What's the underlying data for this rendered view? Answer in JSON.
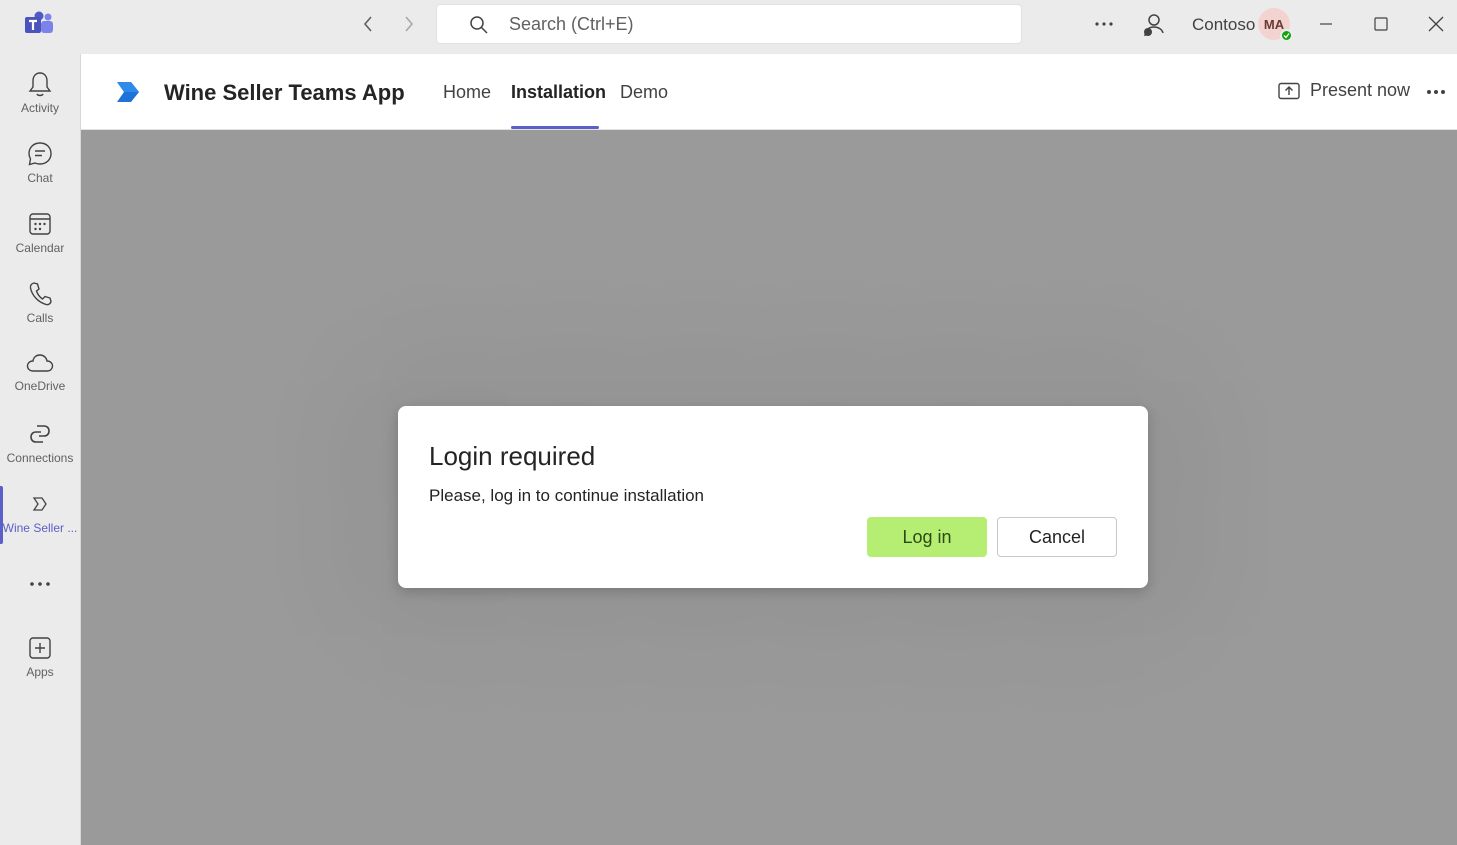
{
  "titlebar": {
    "search_placeholder": "Search (Ctrl+E)",
    "org_name": "Contoso",
    "avatar_initials": "MA"
  },
  "rail": {
    "items": [
      {
        "label": "Activity",
        "icon": "bell-icon"
      },
      {
        "label": "Chat",
        "icon": "chat-icon"
      },
      {
        "label": "Calendar",
        "icon": "calendar-icon"
      },
      {
        "label": "Calls",
        "icon": "phone-icon"
      },
      {
        "label": "OneDrive",
        "icon": "cloud-icon"
      },
      {
        "label": "Connections",
        "icon": "connections-icon"
      },
      {
        "label": "Wine Seller ...",
        "icon": "wine-seller-app-icon"
      },
      {
        "label": "Apps",
        "icon": "add-apps-icon"
      }
    ]
  },
  "app": {
    "title": "Wine Seller Teams App",
    "tabs": [
      "Home",
      "Installation",
      "Demo"
    ],
    "active_tab": "Installation",
    "present_label": "Present now"
  },
  "dialog": {
    "title": "Login required",
    "message": "Please, log in to continue installation",
    "login_label": "Log in",
    "cancel_label": "Cancel"
  },
  "colors": {
    "accent": "#5b5fc7",
    "login_button": "#b5ee72",
    "overlay": "#9a9a9a",
    "presence_available": "#13a10e"
  }
}
